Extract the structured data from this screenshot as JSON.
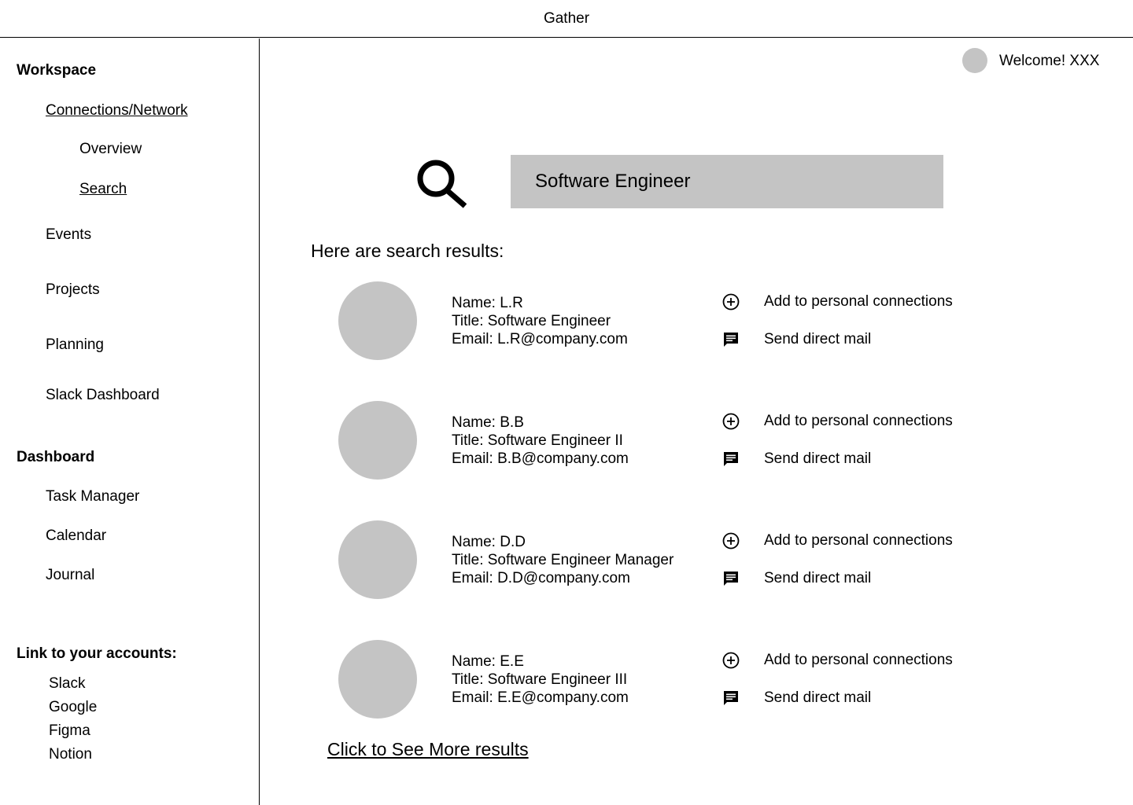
{
  "app": {
    "title": "Gather"
  },
  "sidebar": {
    "workspace_heading": "Workspace",
    "connections_label": "Connections/Network",
    "overview_label": "Overview",
    "search_label": "Search",
    "events_label": "Events",
    "projects_label": "Projects",
    "planning_label": "Planning",
    "slack_dashboard_label": "Slack Dashboard",
    "dashboard_heading": "Dashboard",
    "task_manager_label": "Task Manager",
    "calendar_label": "Calendar",
    "journal_label": "Journal",
    "accounts_heading": "Link to your accounts:",
    "accounts": [
      "Slack",
      "Google",
      "Figma",
      "Notion"
    ]
  },
  "header": {
    "welcome": "Welcome! XXX"
  },
  "search": {
    "value": "Software Engineer"
  },
  "results": {
    "heading": "Here are search results:",
    "add_label": "Add to personal connections",
    "mail_label": "Send direct mail",
    "items": [
      {
        "name": "Name: L.R",
        "title": "Title: Software Engineer",
        "email": "Email: L.R@company.com"
      },
      {
        "name": "Name: B.B",
        "title": "Title: Software Engineer II",
        "email": "Email: B.B@company.com"
      },
      {
        "name": "Name: D.D",
        "title": "Title: Software Engineer Manager",
        "email": "Email: D.D@company.com"
      },
      {
        "name": "Name: E.E",
        "title": "Title: Software Engineer III",
        "email": "Email: E.E@company.com"
      }
    ],
    "more_label": "Click to See More results"
  },
  "icons": {
    "search": "search-icon",
    "add": "plus-circle-icon",
    "mail": "message-icon"
  },
  "colors": {
    "placeholder_gray": "#c4c4c4"
  }
}
